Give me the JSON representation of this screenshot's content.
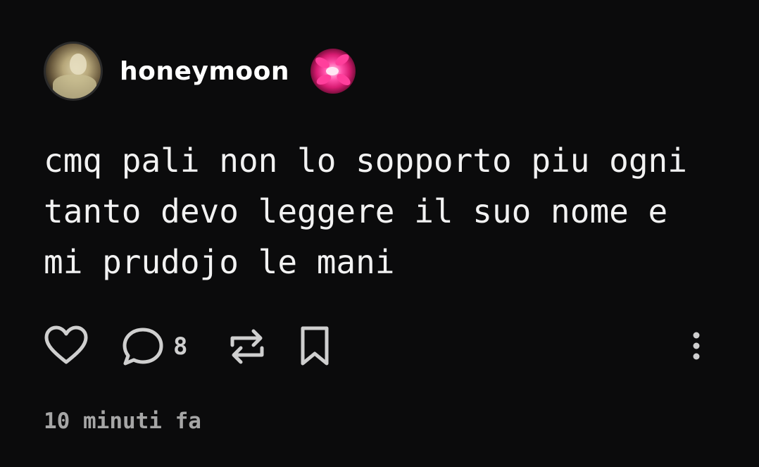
{
  "post": {
    "author": {
      "username": "honeymoon",
      "avatar_icon": "profile-photo",
      "badge_icon": "pink-lily-flower"
    },
    "text": "cmq pali non lo sopporto piu ogni\ntanto devo leggere il suo nome e\nmi prudojo le mani",
    "actions": {
      "like_icon": "heart-outline-icon",
      "comment_icon": "speech-bubble-icon",
      "comment_count": "8",
      "repost_icon": "repost-arrows-icon",
      "bookmark_icon": "bookmark-outline-icon",
      "more_icon": "vertical-dots-icon"
    },
    "timestamp": "10 minuti fa"
  },
  "colors": {
    "background": "#0b0b0c",
    "text": "#f2f2f2",
    "icon": "#cfcfcf",
    "timestamp": "#a6a6a6"
  }
}
